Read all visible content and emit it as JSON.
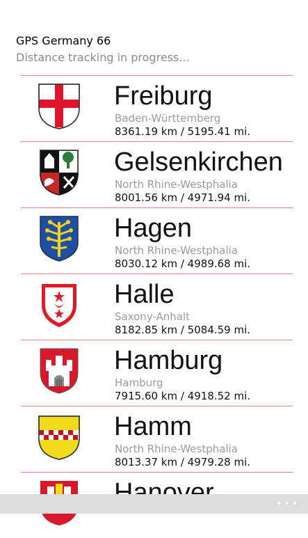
{
  "app": {
    "title": "GPS Germany 66",
    "status": "Distance tracking in progress..."
  },
  "cities": [
    {
      "name": "Freiburg",
      "state": "Baden-Württemberg",
      "distance": "8361.19 km / 5195.41 mi.",
      "crest_icon": "freiburg-crest-icon"
    },
    {
      "name": "Gelsenkirchen",
      "state": "North Rhine-Westphalia",
      "distance": "8001.56 km / 4971.94 mi.",
      "crest_icon": "gelsenkirchen-crest-icon"
    },
    {
      "name": "Hagen",
      "state": "North Rhine-Westphalia",
      "distance": "8030.12 km / 4989.68 mi.",
      "crest_icon": "hagen-crest-icon"
    },
    {
      "name": "Halle",
      "state": "Saxony-Anhalt",
      "distance": "8182.85 km / 5084.59 mi.",
      "crest_icon": "halle-crest-icon"
    },
    {
      "name": "Hamburg",
      "state": "Hamburg",
      "distance": "7915.60 km / 4918.52 mi.",
      "crest_icon": "hamburg-crest-icon"
    },
    {
      "name": "Hamm",
      "state": "North Rhine-Westphalia",
      "distance": "8013.37 km / 4979.28 mi.",
      "crest_icon": "hamm-crest-icon"
    },
    {
      "name": "Hanover",
      "state": "",
      "distance": "",
      "crest_icon": "hanover-crest-icon"
    }
  ],
  "appbar": {
    "more_label": "•••"
  },
  "colors": {
    "divider": "#f08080",
    "secondary_text": "#9a9a9a",
    "appbar": "#dcdcdc"
  }
}
